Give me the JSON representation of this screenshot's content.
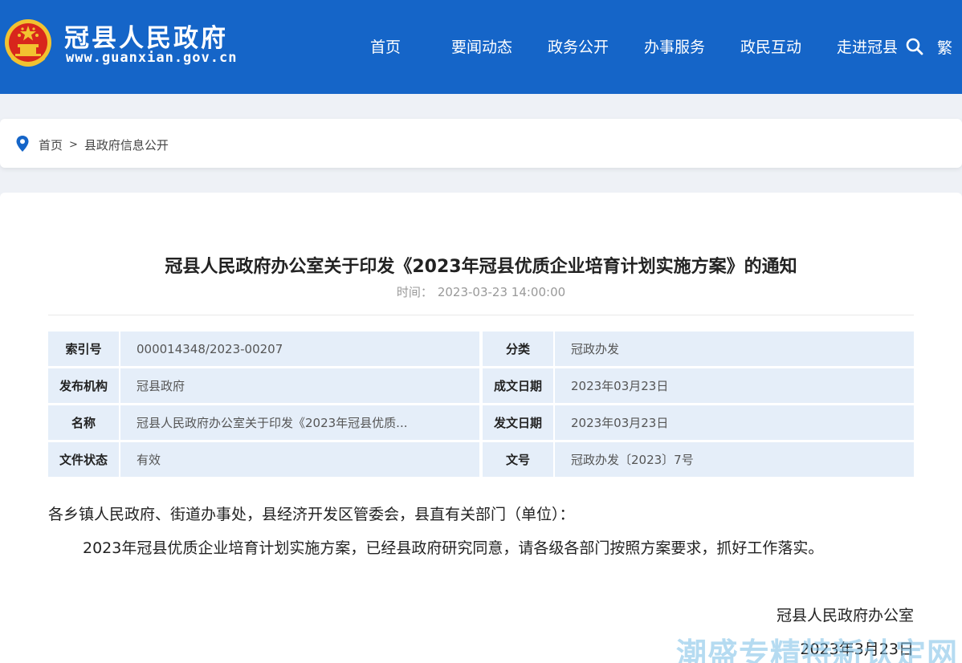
{
  "header": {
    "site_name": "冠县人民政府",
    "site_url": "www.guanxian.gov.cn",
    "nav": [
      "首页",
      "要闻动态",
      "政务公开",
      "办事服务",
      "政民互动",
      "走进冠县"
    ],
    "traditional_label": "繁",
    "search_icon": "search-icon",
    "brand_color": "#1565c8"
  },
  "breadcrumb": {
    "items": [
      "首页",
      "县政府信息公开"
    ],
    "separator": ">"
  },
  "article": {
    "title": "冠县人民政府办公室关于印发《2023年冠县优质企业培育计划实施方案》的通知",
    "time_label": "时间：",
    "time_value": "2023-03-23 14:00:00",
    "meta": [
      {
        "k1": "索引号",
        "v1": "000014348/2023-00207",
        "k2": "分类",
        "v2": "冠政办发"
      },
      {
        "k1": "发布机构",
        "v1": "冠县政府",
        "k2": "成文日期",
        "v2": "2023年03月23日"
      },
      {
        "k1": "名称",
        "v1": "冠县人民政府办公室关于印发《2023年冠县优质...",
        "k2": "发文日期",
        "v2": "2023年03月23日"
      },
      {
        "k1": "文件状态",
        "v1": "有效",
        "k2": "文号",
        "v2": "冠政办发〔2023〕7号"
      }
    ],
    "salutation": "各乡镇人民政府、街道办事处，县经济开发区管委会，县直有关部门（单位）：",
    "body": "2023年冠县优质企业培育计划实施方案，已经县政府研究同意，请各级各部门按照方案要求，抓好工作落实。",
    "sign_org": "冠县人民政府办公室",
    "sign_date": "2023年3月23日"
  },
  "watermark": "潮盛专精特新认定网"
}
